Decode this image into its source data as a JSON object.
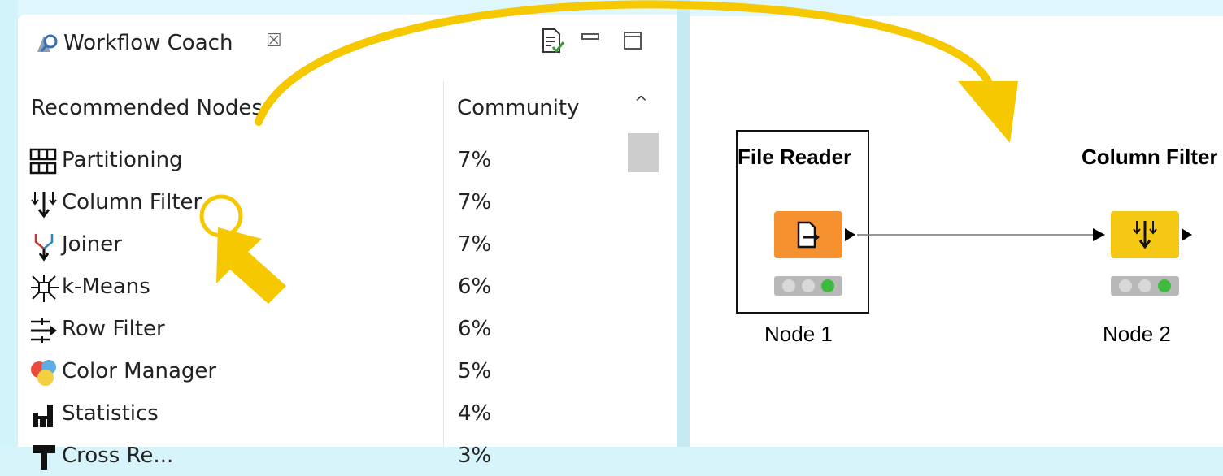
{
  "panel": {
    "tab_title": "Workflow Coach",
    "close_glyph": "☒",
    "columns": {
      "nodes": "Recommended Nodes",
      "community": "Community"
    },
    "rows": [
      {
        "name": "Partitioning",
        "pct": "7%",
        "icon": "partitioning-icon"
      },
      {
        "name": "Column Filter",
        "pct": "7%",
        "icon": "column-filter-icon"
      },
      {
        "name": "Joiner",
        "pct": "7%",
        "icon": "joiner-icon"
      },
      {
        "name": "k-Means",
        "pct": "6%",
        "icon": "k-means-icon"
      },
      {
        "name": "Row Filter",
        "pct": "6%",
        "icon": "row-filter-icon"
      },
      {
        "name": "Color Manager",
        "pct": "5%",
        "icon": "color-manager-icon"
      },
      {
        "name": "Statistics",
        "pct": "4%",
        "icon": "statistics-icon"
      },
      {
        "name": "Cross Re...",
        "pct": "3%",
        "icon": "cross-validation-icon"
      }
    ]
  },
  "workflow": {
    "nodes": [
      {
        "title": "File Reader",
        "label": "Node 1",
        "color": "#f5912f",
        "status": "executed"
      },
      {
        "title": "Column Filter",
        "label": "Node 2",
        "color": "#f5c813",
        "status": "executed"
      }
    ]
  },
  "colors": {
    "background": "#d6f4fa",
    "annotation": "#f5c800",
    "status_green": "#3dbb3d"
  }
}
